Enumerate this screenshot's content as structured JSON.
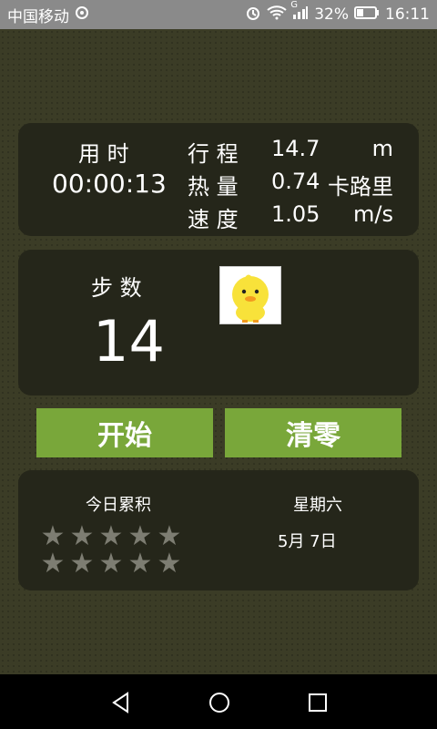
{
  "status": {
    "carrier": "中国移动",
    "signal_label": "G",
    "battery": "32%",
    "time": "16:11"
  },
  "card_metrics": {
    "time_label": "用 时",
    "time_value": "00:00:13",
    "rows": [
      {
        "label": "行 程",
        "value": "14.7",
        "unit": "m"
      },
      {
        "label": "热 量",
        "value": "0.74",
        "unit": "卡路里"
      },
      {
        "label": "速 度",
        "value": "1.05",
        "unit": "m/s"
      }
    ]
  },
  "steps": {
    "label": "步 数",
    "value": "14"
  },
  "buttons": {
    "start": "开始",
    "reset": "清零"
  },
  "summary": {
    "today_label": "今日累积",
    "weekday": "星期六",
    "date": "5月 7日",
    "stars_total": 10,
    "stars_filled": 0
  },
  "colors": {
    "accent": "#79a73a",
    "card": "#25261a",
    "background": "#3b3c26"
  }
}
